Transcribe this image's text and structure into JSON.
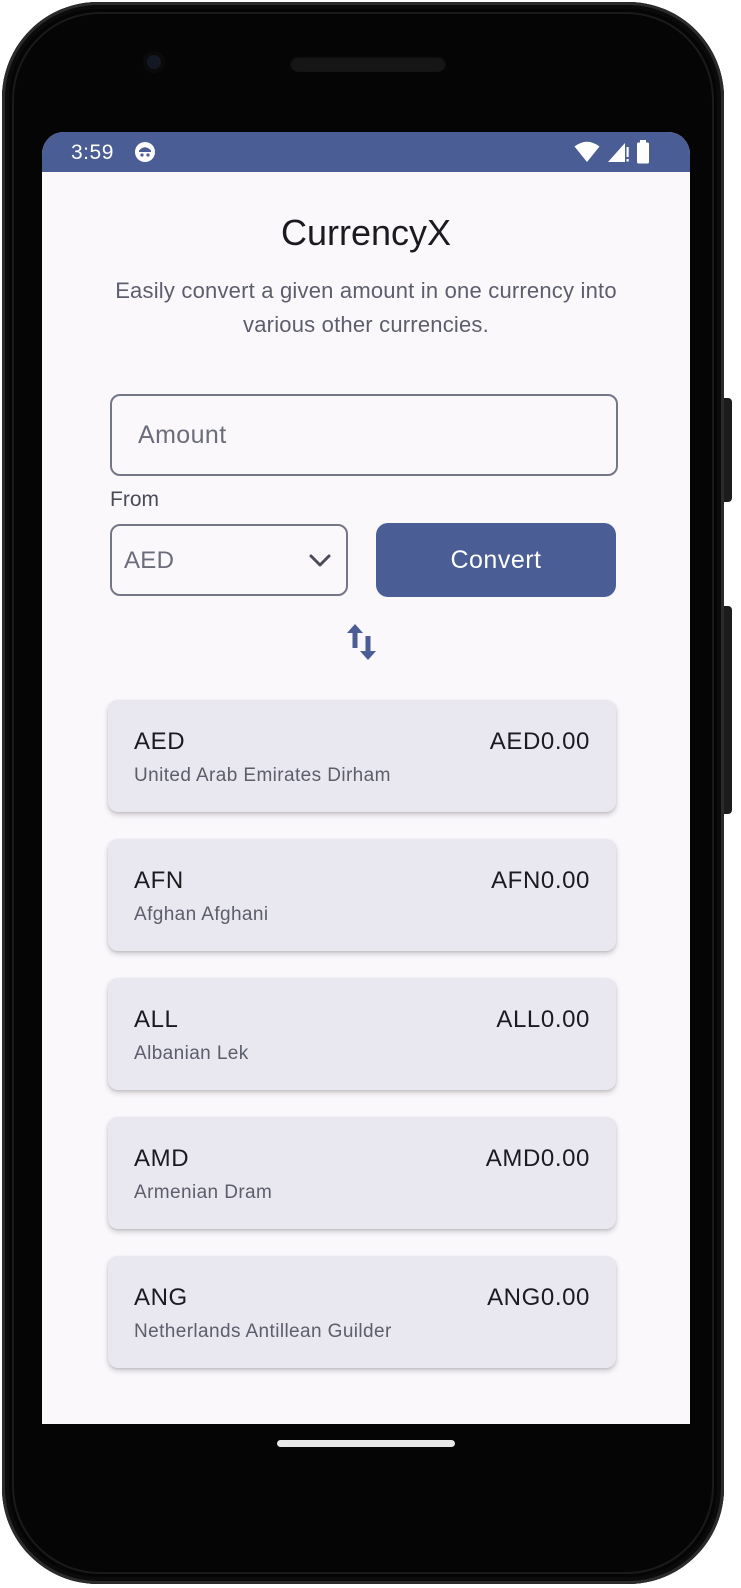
{
  "status_bar": {
    "time": "3:59",
    "background": "#4a5d94",
    "icons": [
      "app-notification-icon",
      "wifi-icon",
      "signal-icon",
      "battery-icon"
    ]
  },
  "app": {
    "title": "CurrencyX",
    "subtitle": "Easily convert a given amount in one currency into various other currencies.",
    "accent_color": "#4a5d94"
  },
  "form": {
    "amount_placeholder": "Amount",
    "amount_value": "",
    "from_label": "From",
    "from_selected": "AED",
    "convert_label": "Convert",
    "swap_icon": "swap-vertical-icon"
  },
  "currencies": [
    {
      "code": "AED",
      "name": "United Arab Emirates Dirham",
      "amount": "AED0.00"
    },
    {
      "code": "AFN",
      "name": "Afghan Afghani",
      "amount": "AFN0.00"
    },
    {
      "code": "ALL",
      "name": "Albanian Lek",
      "amount": "ALL0.00"
    },
    {
      "code": "AMD",
      "name": "Armenian Dram",
      "amount": "AMD0.00"
    },
    {
      "code": "ANG",
      "name": "Netherlands Antillean Guilder",
      "amount": "ANG0.00"
    }
  ]
}
